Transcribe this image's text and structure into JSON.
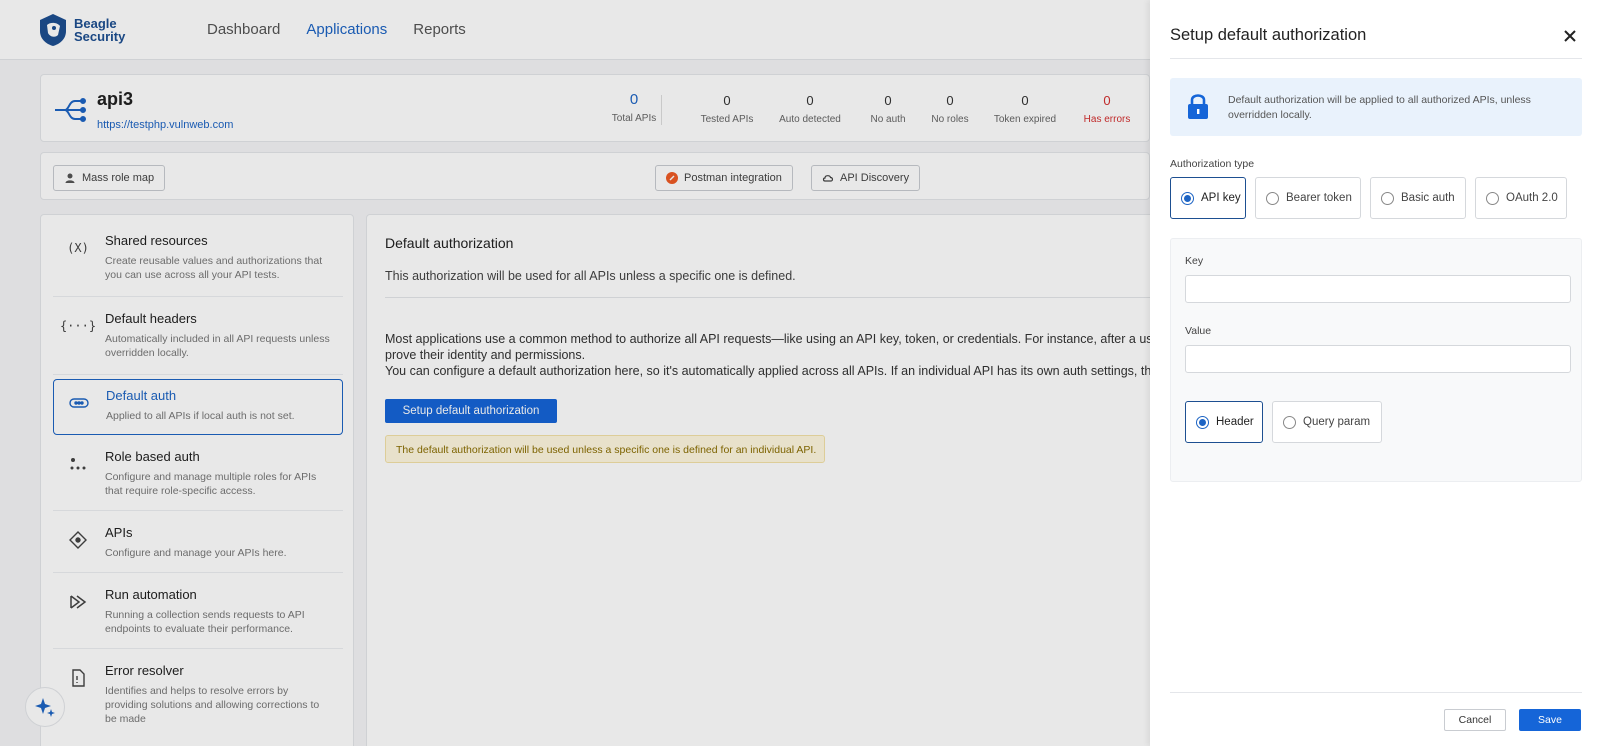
{
  "brand": {
    "line1": "Beagle",
    "line2": "Security"
  },
  "nav": [
    {
      "label": "Dashboard",
      "active": false
    },
    {
      "label": "Applications",
      "active": true
    },
    {
      "label": "Reports",
      "active": false
    }
  ],
  "app": {
    "name": "api3",
    "url": "https://testphp.vulnweb.com"
  },
  "stats": [
    {
      "value": "0",
      "label": "Total APIs"
    },
    {
      "value": "0",
      "label": "Tested APIs"
    },
    {
      "value": "0",
      "label": "Auto detected"
    },
    {
      "value": "0",
      "label": "No auth"
    },
    {
      "value": "0",
      "label": "No roles"
    },
    {
      "value": "0",
      "label": "Token expired"
    },
    {
      "value": "0",
      "label": "Has errors"
    }
  ],
  "toolbar": {
    "mass_role_map": "Mass role map",
    "postman_integration": "Postman integration",
    "api_discovery": "API Discovery"
  },
  "sidebar": [
    {
      "title": "Shared resources",
      "desc": "Create reusable values and authorizations that you can use across all your API tests.",
      "icon": "(X)"
    },
    {
      "title": "Default headers",
      "desc": "Automatically included in all API requests unless overridden locally.",
      "icon": "{···}"
    },
    {
      "title": "Default auth",
      "desc": "Applied to all APIs if local auth is not set.",
      "icon": ""
    },
    {
      "title": "Role based auth",
      "desc": "Configure and manage multiple roles for APIs that require role-specific access.",
      "icon": ""
    },
    {
      "title": "APIs",
      "desc": "Configure and manage your APIs here.",
      "icon": ""
    },
    {
      "title": "Run automation",
      "desc": "Running a collection sends requests to API endpoints to evaluate their performance.",
      "icon": ""
    },
    {
      "title": "Error resolver",
      "desc": "Identifies and helps to resolve errors by providing solutions and allowing corrections to be made",
      "icon": ""
    }
  ],
  "content": {
    "title": "Default authorization",
    "subtitle": "This authorization will be used for all APIs unless a specific one is defined.",
    "body_line1": "Most applications use a common method to authorize all API requests—like using an API key, token, or credentials. For instance, after a user",
    "body_line2": "prove their identity and permissions.",
    "body_line3": "You can configure a default authorization here, so it's automatically applied across all APIs. If an individual API has its own auth settings, tho",
    "setup_button": "Setup default authorization",
    "note": "The default authorization will be used unless a specific one is defined for an individual API."
  },
  "drawer": {
    "title": "Setup default authorization",
    "info": "Default authorization will be applied to all authorized APIs, unless overridden locally.",
    "auth_type_label": "Authorization type",
    "auth_types": [
      {
        "label": "API key",
        "selected": true
      },
      {
        "label": "Bearer token",
        "selected": false
      },
      {
        "label": "Basic auth",
        "selected": false
      },
      {
        "label": "OAuth 2.0",
        "selected": false
      }
    ],
    "key_label": "Key",
    "key_value": "",
    "value_label": "Value",
    "value_value": "",
    "locations": [
      {
        "label": "Header",
        "selected": true
      },
      {
        "label": "Query param",
        "selected": false
      }
    ],
    "cancel": "Cancel",
    "save": "Save"
  },
  "colors": {
    "primary": "#1565d8",
    "brand": "#1d4f91",
    "error": "#d32f2f"
  }
}
